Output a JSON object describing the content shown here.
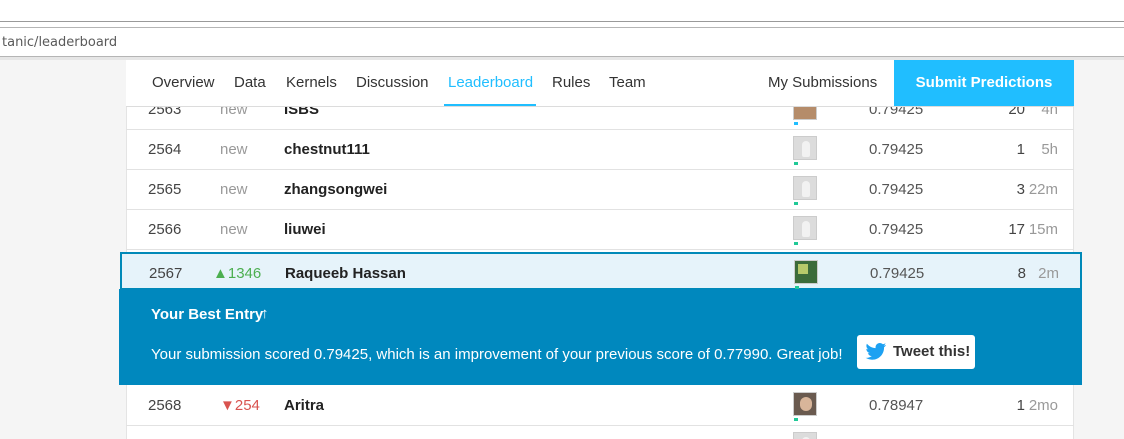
{
  "browser": {
    "url": "tanic/leaderboard"
  },
  "nav": {
    "tabs": [
      "Overview",
      "Data",
      "Kernels",
      "Discussion",
      "Leaderboard",
      "Rules",
      "Team"
    ],
    "active_tab": "Leaderboard",
    "my_submissions": "My Submissions",
    "submit_predictions": "Submit Predictions"
  },
  "rows": [
    {
      "rank": "2563",
      "move": "new",
      "team": "ISBS",
      "score": "0.79425",
      "entries": "20",
      "last": "4h"
    },
    {
      "rank": "2564",
      "move": "new",
      "team": "chestnut111",
      "score": "0.79425",
      "entries": "1",
      "last": "5h"
    },
    {
      "rank": "2565",
      "move": "new",
      "team": "zhangsongwei",
      "score": "0.79425",
      "entries": "3",
      "last": "22m"
    },
    {
      "rank": "2566",
      "move": "new",
      "team": "liuwei",
      "score": "0.79425",
      "entries": "17",
      "last": "15m"
    },
    {
      "rank": "2567",
      "move": "▲1346",
      "team": "Raqueeb Hassan",
      "score": "0.79425",
      "entries": "8",
      "last": "2m"
    },
    {
      "rank": "2568",
      "move": "▼254",
      "team": "Aritra",
      "score": "0.78947",
      "entries": "1",
      "last": "2mo"
    }
  ],
  "best_entry": {
    "title": "Your Best Entry",
    "arrow": "↑",
    "message": "Your submission scored 0.79425, which is an improvement of your previous score of 0.77990. Great job!",
    "tweet_label": "Tweet this!"
  },
  "colors": {
    "accent": "#20beff",
    "banner": "#0088be",
    "up": "#4caf50",
    "down": "#d9534f"
  }
}
